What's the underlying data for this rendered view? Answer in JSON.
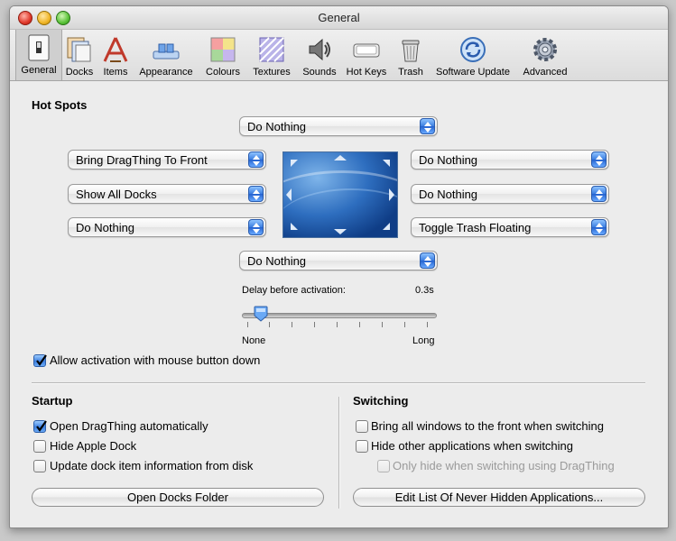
{
  "window": {
    "title": "General"
  },
  "toolbar": {
    "items": [
      {
        "label": "General",
        "icon": "general-switch-icon"
      },
      {
        "label": "Docks",
        "icon": "docks-icon"
      },
      {
        "label": "Items",
        "icon": "items-icon"
      },
      {
        "label": "Appearance",
        "icon": "appearance-icon"
      },
      {
        "label": "Colours",
        "icon": "colours-icon"
      },
      {
        "label": "Textures",
        "icon": "textures-icon"
      },
      {
        "label": "Sounds",
        "icon": "speaker-icon"
      },
      {
        "label": "Hot Keys",
        "icon": "keyboard-key-icon"
      },
      {
        "label": "Trash",
        "icon": "trash-icon"
      },
      {
        "label": "Software Update",
        "icon": "software-update-icon"
      },
      {
        "label": "Advanced",
        "icon": "gear-icon"
      }
    ],
    "selected": "General"
  },
  "hotspots": {
    "heading": "Hot Spots",
    "top": "Do Nothing",
    "left_top": "Bring DragThing To Front",
    "left_middle": "Show All Docks",
    "left_bottom": "Do Nothing",
    "right_top": "Do Nothing",
    "right_middle": "Do Nothing",
    "right_bottom": "Toggle Trash Floating",
    "bottom": "Do Nothing",
    "delay_label": "Delay before activation:",
    "delay_value": "0.3s",
    "slider_min_label": "None",
    "slider_max_label": "Long",
    "slider_fraction": 0.1,
    "allow_mouse_down": {
      "label": "Allow activation with mouse button down",
      "checked": true
    }
  },
  "startup": {
    "heading": "Startup",
    "options": [
      {
        "label": "Open DragThing automatically",
        "checked": true
      },
      {
        "label": "Hide Apple Dock",
        "checked": false
      },
      {
        "label": "Update dock item information from disk",
        "checked": false
      }
    ],
    "button": "Open Docks Folder"
  },
  "switching": {
    "heading": "Switching",
    "options": [
      {
        "label": "Bring all windows to the front when switching",
        "checked": false,
        "enabled": true
      },
      {
        "label": "Hide other applications when switching",
        "checked": false,
        "enabled": true
      },
      {
        "label": "Only hide when switching using DragThing",
        "checked": false,
        "enabled": false
      }
    ],
    "button": "Edit List Of Never Hidden Applications..."
  },
  "colors": {
    "accent": "#3a7de0",
    "window_bg": "#ececec"
  }
}
